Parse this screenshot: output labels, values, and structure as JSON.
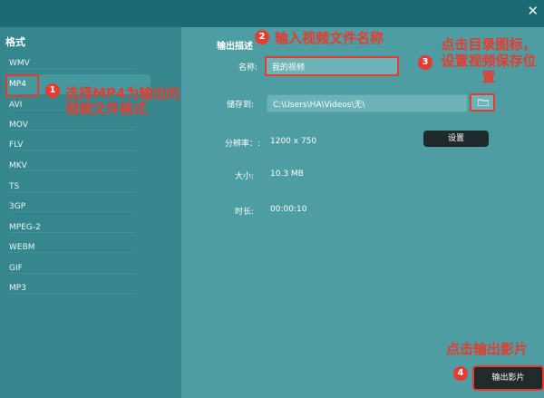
{
  "window": {
    "close_icon": "✕"
  },
  "format_panel": {
    "title": "格式",
    "items": [
      "WMV",
      "MP4",
      "AVI",
      "MOV",
      "FLV",
      "MKV",
      "TS",
      "3GP",
      "MPEG-2",
      "WEBM",
      "GIF",
      "MP3"
    ],
    "selected": "MP4"
  },
  "output_panel": {
    "section_title": "输出描述",
    "name_label": "名称:",
    "name_value": "我的视频",
    "save_label": "储存到:",
    "save_value": "C:\\Users\\HA\\Videos\\无\\",
    "resolution_label": "分辨率：:",
    "resolution_value": "1200 x 750",
    "settings_button": "设置",
    "size_label": "大小:",
    "size_value": "10.3 MB",
    "duration_label": "时长:",
    "duration_value": "00:00:10",
    "export_button": "输出影片"
  },
  "annotations": {
    "a1_num": "1",
    "a1_text": "选择MP4为输出的\n视频文件格式",
    "a2_num": "2",
    "a2_text": "输入视频文件名称",
    "a3_num": "3",
    "a3_text": "点击目录图标，\n设置视频保存位\n置",
    "a4_num": "4",
    "a4_text": "点击输出影片"
  },
  "colors": {
    "accent": "#e63b2e",
    "panel_left": "#35878d",
    "panel_right": "#4e9da2"
  }
}
